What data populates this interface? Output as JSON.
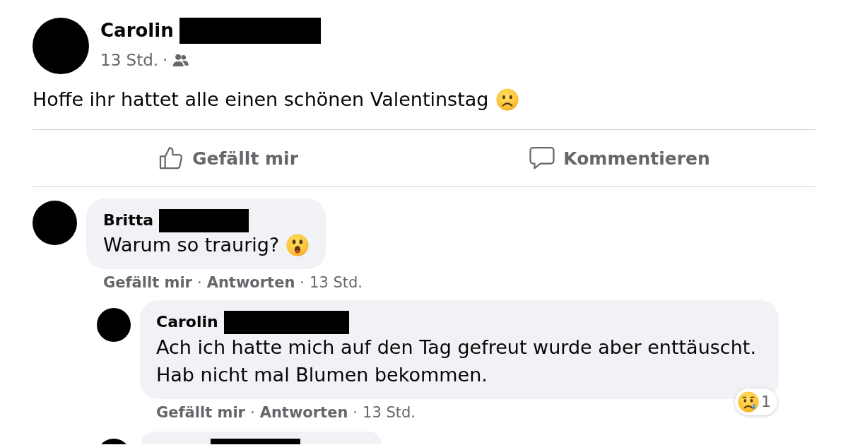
{
  "post": {
    "author": "Carolin",
    "author_redacted": true,
    "meta": [
      {
        "kind": "time",
        "label": "13 Std."
      },
      {
        "kind": "separator",
        "label": "·"
      }
    ],
    "text": "Hoffe ihr hattet alle einen schönen Valentinstag",
    "emoji": {
      "kind": "frowning"
    }
  },
  "actions": [
    {
      "kind": "like",
      "label": "Gefällt mir"
    },
    {
      "kind": "comment",
      "label": "Kommentieren"
    }
  ],
  "comments": [
    {
      "author": "Britta",
      "author_redacted": true,
      "text": "Warum so traurig?",
      "emoji": {
        "kind": "astonished"
      },
      "footer": [
        {
          "kind": "like",
          "label": "Gefällt mir"
        },
        {
          "kind": "separator",
          "label": "·"
        },
        {
          "kind": "reply",
          "label": "Antworten"
        },
        {
          "kind": "separator",
          "label": "·"
        },
        {
          "kind": "time",
          "label": "13 Std."
        }
      ],
      "replies": [
        {
          "author": "Carolin",
          "author_redacted": true,
          "text": "Ach ich hatte mich auf den Tag gefreut wurde aber enttäuscht. Hab nicht mal Blumen bekommen.",
          "reaction": {
            "kind": "crying",
            "count": "1"
          },
          "footer": [
            {
              "kind": "like",
              "label": "Gefällt mir"
            },
            {
              "kind": "separator",
              "label": "·"
            },
            {
              "kind": "reply",
              "label": "Antworten"
            },
            {
              "kind": "separator",
              "label": "·"
            },
            {
              "kind": "time",
              "label": "13 Std."
            }
          ]
        },
        {
          "author_redacted": true
        }
      ]
    }
  ]
}
